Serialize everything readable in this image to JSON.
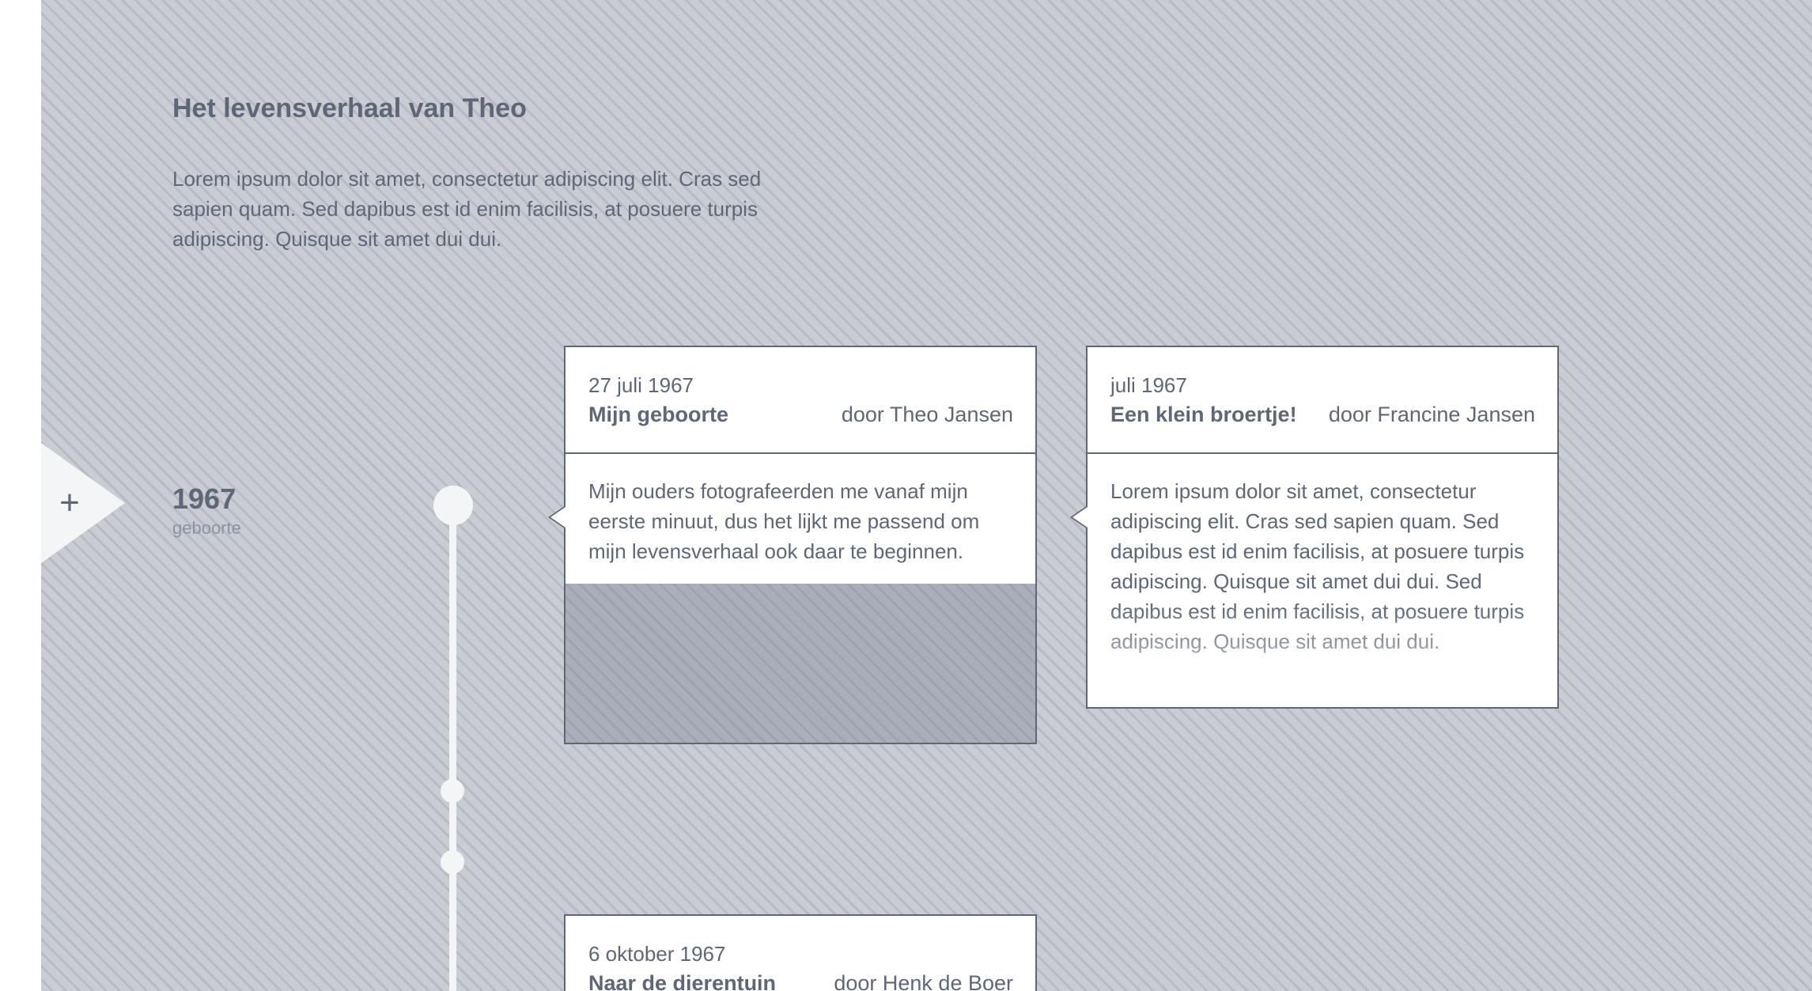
{
  "page": {
    "title": "Het levensverhaal van Theo",
    "intro": "Lorem ipsum dolor sit amet, consectetur adipiscing elit. Cras sed sapien quam. Sed dapibus est id enim facilisis, at posuere turpis adipiscing. Quisque sit amet dui dui."
  },
  "sidebar": {
    "add_icon": "plus-icon",
    "add_glyph": "+"
  },
  "year": {
    "label": "1967",
    "sub": "geboorte"
  },
  "stories": [
    {
      "date": "27 juli 1967",
      "title": "Mijn geboorte",
      "author": "door Theo Jansen",
      "text": "Mijn ouders fotografeerden me vanaf mijn eerste minuut, dus het lijkt me passend om mijn levensverhaal ook daar te beginnen."
    },
    {
      "date": "juli 1967",
      "title": "Een klein broertje!",
      "author": "door Francine Jansen",
      "text": "Lorem ipsum dolor sit amet, consectetur adipiscing elit. Cras sed sapien quam. Sed dapibus est id enim facilisis, at posuere turpis adipiscing. Quisque sit amet dui dui. Sed dapibus est id enim facilisis, at posuere turpis adipiscing. Quisque sit amet dui dui."
    },
    {
      "date": "6 oktober 1967",
      "title": "Naar de dierentuin",
      "author": "door Henk de Boer"
    }
  ],
  "colors": {
    "text": "#5d6777",
    "background": "#c8cbd2",
    "card": "#ffffff",
    "timeline": "#f4f5f7"
  }
}
